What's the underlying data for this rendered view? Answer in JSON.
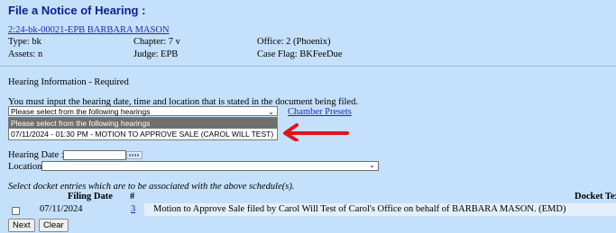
{
  "page": {
    "title": "File a Notice of Hearing :"
  },
  "case": {
    "link_text": "2:24-bk-00021-EPB BARBARA MASON",
    "type": "Type: bk",
    "chapter": "Chapter: 7 v",
    "office": "Office: 2 (Phoenix)",
    "assets": "Assets: n",
    "judge": "Judge: EPB",
    "case_flag": "Case Flag: BKFeeDue"
  },
  "hearing": {
    "section_label": "Hearing Information - Required",
    "instruction": "You must input the hearing date, time and location that is stated in the document being filed.",
    "select_value": "Please select from the following hearings",
    "chamber_presets": "Chamber Presets",
    "options": [
      "Please select from the following hearings",
      "07/11/2024 - 01:30 PM - MOTION TO APPROVE SALE (CAROL WILL TEST)"
    ],
    "date_label": "Hearing Date :",
    "date_value": "",
    "location_label": "Location",
    "location_value": ""
  },
  "docket": {
    "instruction": "Select docket entries which are to be associated with the above schedule(s).",
    "headers": {
      "filing_date": "Filing Date",
      "number": "#",
      "docket_text": "Docket Tex"
    },
    "rows": [
      {
        "checked": false,
        "filing_date": "07/11/2024",
        "number": "3",
        "text": "Motion to Approve Sale filed by Carol Will Test of Carol's Office on behalf of BARBARA MASON. (EMD)"
      }
    ]
  },
  "buttons": {
    "next": "Next",
    "clear": "Clear"
  },
  "colors": {
    "background": "#c5e0fb",
    "title": "#0c1f8c",
    "link": "#1f2ab5",
    "arrow": "#e0141e",
    "selected_option": "#6f6f6f"
  },
  "icons": {
    "calendar": "calendar-icon",
    "arrow": "red-arrow-icon",
    "dropdown": "chevron-down-icon"
  }
}
